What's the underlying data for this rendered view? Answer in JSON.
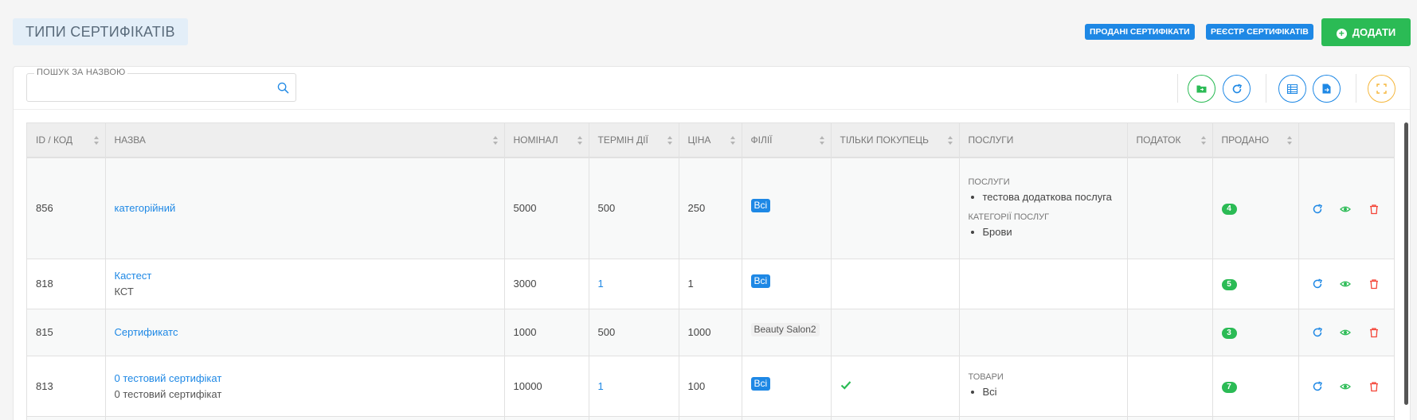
{
  "header": {
    "title": "ТИПИ СЕРТИФІКАТІВ",
    "sold_button": "ПРОДАНІ СЕРТИФІКАТИ",
    "registry_button": "РЕЄСТР СЕРТИФІКАТІВ",
    "add_button": "ДОДАТИ"
  },
  "search": {
    "label": "ПОШУК ЗА НАЗВОЮ",
    "value": "",
    "placeholder": ""
  },
  "table": {
    "columns": [
      "ID / КОД",
      "НАЗВА",
      "НОМІНАЛ",
      "ТЕРМІН ДІЇ",
      "ЦІНА",
      "ФІЛІЇ",
      "ТІЛЬКИ ПОКУПЕЦЬ",
      "ПОСЛУГИ",
      "ПОДАТОК",
      "ПРОДАНО",
      ""
    ],
    "rows": [
      {
        "id": "856",
        "name": "категорійний",
        "code": "",
        "nominal": "5000",
        "term": "500",
        "price": "250",
        "branch": "Всі",
        "buyer_only": false,
        "services": [
          {
            "heading": "ПОСЛУГИ",
            "items": [
              "тестова додаткова послуга"
            ]
          },
          {
            "heading": "КАТЕГОРІЇ ПОСЛУГ",
            "items": [
              "Брови"
            ]
          }
        ],
        "tax": "",
        "sold": "4"
      },
      {
        "id": "818",
        "name": "Кастест",
        "code": "КСТ",
        "nominal": "3000",
        "term": "1",
        "price": "1",
        "branch": "Всі",
        "buyer_only": false,
        "services": [],
        "tax": "",
        "sold": "5"
      },
      {
        "id": "815",
        "name": "Сертификатс",
        "code": "",
        "nominal": "1000",
        "term": "500",
        "price": "1000",
        "branch": "Beauty Salon2",
        "buyer_only": false,
        "services": [],
        "tax": "",
        "sold": "3"
      },
      {
        "id": "813",
        "name": "0 тестовий сертифікат",
        "code": "0 тестовий сертифікат",
        "nominal": "10000",
        "term": "1",
        "price": "100",
        "branch": "Всі",
        "buyer_only": true,
        "services": [
          {
            "heading": "ТОВАРИ",
            "items": [
              "Всі"
            ]
          }
        ],
        "tax": "",
        "sold": "7"
      }
    ]
  },
  "colors": {
    "primary": "#1e88e5",
    "success": "#2bbb55",
    "danger": "#f44336",
    "warning": "#f5b73d"
  },
  "icons": {
    "search": "search-icon",
    "folder": "folder-icon",
    "refresh": "refresh-icon",
    "columns": "columns-icon",
    "export": "file-export-icon",
    "fullscreen": "fullscreen-icon",
    "row_actions": [
      "refresh-icon",
      "eye-icon",
      "trash-icon"
    ]
  }
}
